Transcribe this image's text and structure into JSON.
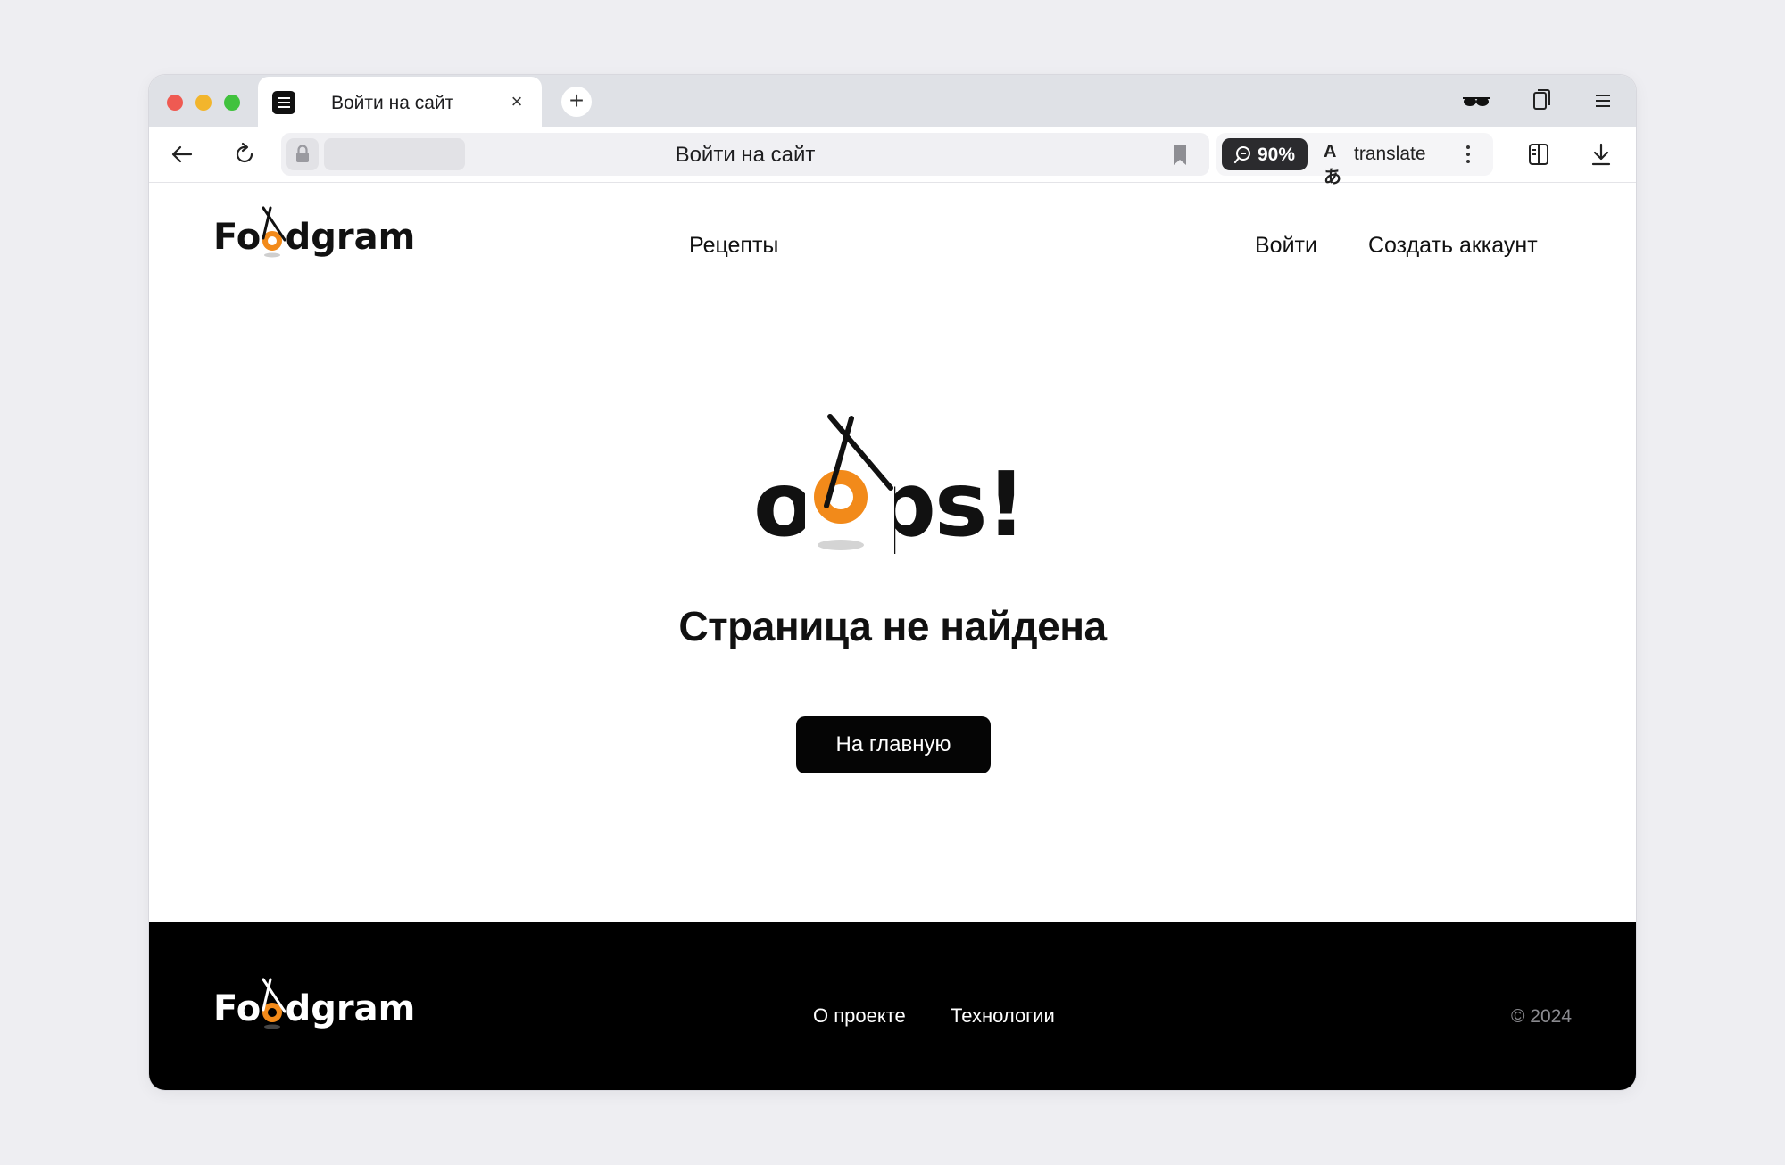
{
  "browser": {
    "tab_title": "Войти на сайт",
    "tab_close": "×",
    "new_tab": "+",
    "address_title": "Войти на сайт",
    "zoom": "90%",
    "translate_label": "translate",
    "translate_glyph": "Aあ"
  },
  "header": {
    "logo_text": "Foodgram",
    "nav_recipes": "Рецепты",
    "nav_login": "Войти",
    "nav_signup": "Создать аккаунт"
  },
  "main": {
    "oops_text": "oops!",
    "title": "Страница не найдена",
    "home_button": "На главную"
  },
  "footer": {
    "logo_text": "Foodgram",
    "about": "О проекте",
    "tech": "Технологии",
    "copyright": "© 2024"
  },
  "colors": {
    "accent": "#f28a1a",
    "footer_bg": "#000000",
    "button_bg": "#050505"
  }
}
